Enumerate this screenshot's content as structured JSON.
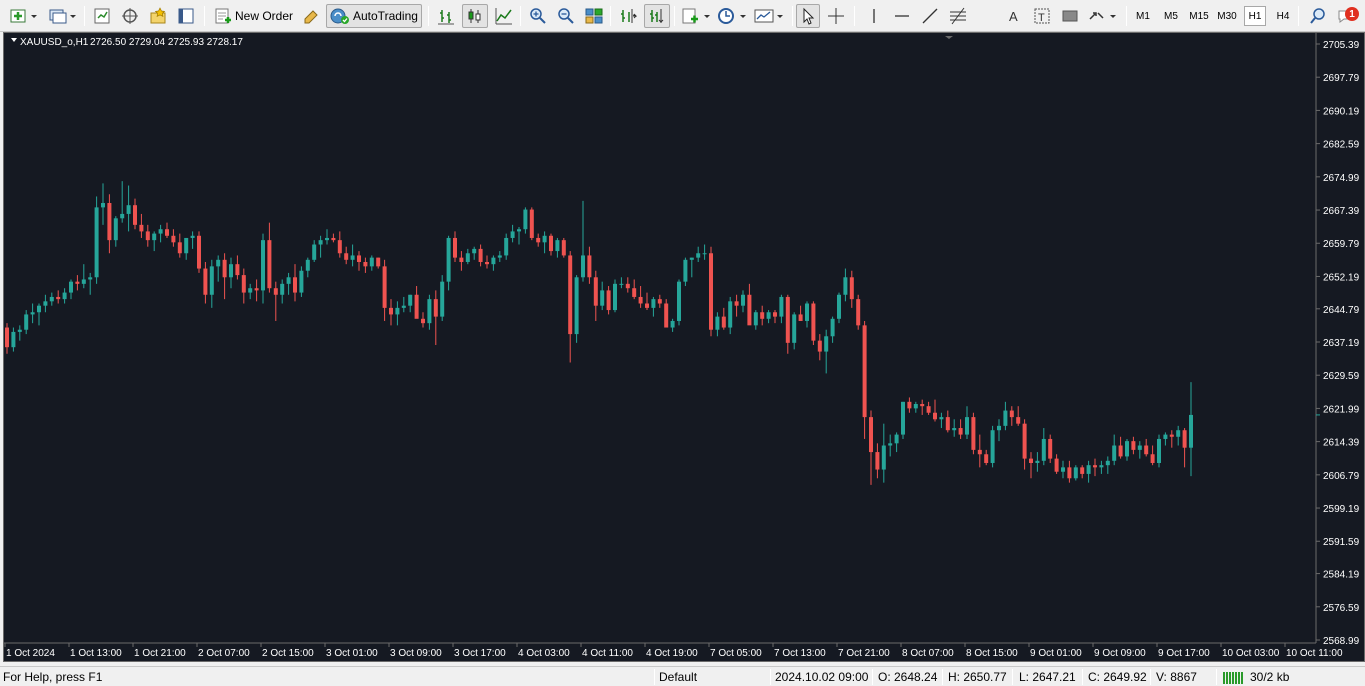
{
  "toolbar": {
    "new_order_label": "New Order",
    "autotrading_label": "AutoTrading",
    "timeframes": [
      "M1",
      "M5",
      "M15",
      "M30",
      "H1",
      "H4"
    ],
    "active_timeframe": "H1",
    "notification_count": "1",
    "icons": [
      "new-chart-icon",
      "profiles-icon",
      "market-watch-icon",
      "navigator-icon",
      "favorites-icon",
      "terminal-icon",
      "new-order-icon",
      "metaeditor-icon",
      "autotrading-icon",
      "bar-chart-icon",
      "candlestick-icon",
      "line-chart-icon",
      "zoom-in-icon",
      "zoom-out-icon",
      "tile-windows-icon",
      "chart-shift-icon",
      "autoscroll-icon",
      "indicators-icon",
      "periods-icon",
      "templates-icon",
      "cursor-icon",
      "crosshair-icon",
      "vertical-line-icon",
      "horizontal-line-icon",
      "trendline-icon",
      "fibonacci-icon",
      "text-icon",
      "text-label-icon",
      "rectangle-icon",
      "arrows-icon",
      "search-icon",
      "notifications-icon"
    ]
  },
  "chart": {
    "header": "XAUUSD_o,H1",
    "header_values": "2726.50 2729.04 2725.93 2728.17",
    "colors": {
      "background": "#151922",
      "bull": "#26a69a",
      "bear": "#ef5350",
      "axis_text": "#ffffff",
      "grid_border": "#6b6b6b"
    }
  },
  "chart_data": {
    "type": "candlestick",
    "symbol": "XAUUSD_o",
    "timeframe": "H1",
    "ylim": [
      2568.99,
      2705.39
    ],
    "y_ticks": [
      "2705.39",
      "2697.79",
      "2690.19",
      "2682.59",
      "2674.99",
      "2667.39",
      "2659.79",
      "2652.19",
      "2644.79",
      "2637.19",
      "2629.59",
      "2621.99",
      "2614.39",
      "2606.79",
      "2599.19",
      "2591.59",
      "2584.19",
      "2576.59",
      "2568.99"
    ],
    "x_ticks": [
      "1 Oct 2024",
      "1 Oct 13:00",
      "1 Oct 21:00",
      "2 Oct 07:00",
      "2 Oct 15:00",
      "3 Oct 01:00",
      "3 Oct 09:00",
      "3 Oct 17:00",
      "4 Oct 03:00",
      "4 Oct 11:00",
      "4 Oct 19:00",
      "7 Oct 05:00",
      "7 Oct 13:00",
      "7 Oct 21:00",
      "8 Oct 07:00",
      "8 Oct 15:00",
      "9 Oct 01:00",
      "9 Oct 09:00",
      "9 Oct 17:00",
      "10 Oct 03:00",
      "10 Oct 11:00"
    ],
    "last_price": 2620.5,
    "candles_ohlc": [
      [
        2640.5,
        2641.5,
        2634.5,
        2636.0
      ],
      [
        2636.0,
        2640.5,
        2635.0,
        2639.5
      ],
      [
        2639.5,
        2641.0,
        2637.5,
        2640.0
      ],
      [
        2640.0,
        2644.5,
        2639.0,
        2643.5
      ],
      [
        2643.5,
        2646.0,
        2641.5,
        2644.0
      ],
      [
        2644.0,
        2646.0,
        2641.0,
        2645.5
      ],
      [
        2645.5,
        2648.0,
        2644.0,
        2646.5
      ],
      [
        2646.5,
        2648.5,
        2645.5,
        2647.5
      ],
      [
        2647.5,
        2649.0,
        2646.0,
        2647.0
      ],
      [
        2647.0,
        2649.5,
        2646.0,
        2648.5
      ],
      [
        2648.5,
        2651.5,
        2647.0,
        2651.0
      ],
      [
        2651.0,
        2652.5,
        2649.0,
        2650.5
      ],
      [
        2650.5,
        2655.0,
        2649.5,
        2651.5
      ],
      [
        2651.5,
        2653.0,
        2648.0,
        2652.0
      ],
      [
        2652.0,
        2670.5,
        2650.5,
        2668.0
      ],
      [
        2668.0,
        2673.5,
        2664.0,
        2669.0
      ],
      [
        2669.0,
        2671.0,
        2657.5,
        2660.5
      ],
      [
        2660.5,
        2666.0,
        2659.0,
        2665.5
      ],
      [
        2665.5,
        2674.0,
        2664.5,
        2666.5
      ],
      [
        2666.5,
        2673.0,
        2662.5,
        2668.5
      ],
      [
        2668.5,
        2670.0,
        2663.0,
        2664.0
      ],
      [
        2664.0,
        2666.5,
        2661.0,
        2662.5
      ],
      [
        2662.5,
        2664.0,
        2659.0,
        2660.5
      ],
      [
        2660.5,
        2662.5,
        2658.0,
        2662.0
      ],
      [
        2662.0,
        2664.0,
        2660.0,
        2663.0
      ],
      [
        2663.0,
        2664.5,
        2661.0,
        2661.5
      ],
      [
        2661.5,
        2663.0,
        2659.0,
        2660.0
      ],
      [
        2660.0,
        2662.0,
        2656.5,
        2657.5
      ],
      [
        2657.5,
        2661.0,
        2656.0,
        2661.0
      ],
      [
        2661.0,
        2662.5,
        2658.5,
        2661.5
      ],
      [
        2661.5,
        2662.5,
        2653.0,
        2654.0
      ],
      [
        2654.0,
        2655.5,
        2646.0,
        2648.0
      ],
      [
        2648.0,
        2656.0,
        2645.0,
        2654.5
      ],
      [
        2654.5,
        2657.0,
        2651.0,
        2656.0
      ],
      [
        2656.0,
        2657.5,
        2647.0,
        2652.0
      ],
      [
        2652.0,
        2656.5,
        2649.5,
        2655.0
      ],
      [
        2655.0,
        2657.0,
        2651.5,
        2652.5
      ],
      [
        2652.5,
        2654.0,
        2646.0,
        2648.5
      ],
      [
        2648.5,
        2650.5,
        2647.0,
        2649.5
      ],
      [
        2649.5,
        2651.5,
        2646.5,
        2649.0
      ],
      [
        2649.0,
        2662.0,
        2646.0,
        2660.5
      ],
      [
        2660.5,
        2664.5,
        2648.5,
        2649.5
      ],
      [
        2649.5,
        2651.0,
        2642.0,
        2648.0
      ],
      [
        2648.0,
        2651.5,
        2646.0,
        2650.5
      ],
      [
        2650.5,
        2653.0,
        2648.0,
        2652.0
      ],
      [
        2652.0,
        2655.0,
        2646.5,
        2648.5
      ],
      [
        2648.5,
        2654.5,
        2647.5,
        2653.5
      ],
      [
        2653.5,
        2656.5,
        2652.0,
        2656.0
      ],
      [
        2656.0,
        2660.5,
        2655.5,
        2659.5
      ],
      [
        2659.5,
        2661.5,
        2656.5,
        2660.5
      ],
      [
        2660.5,
        2663.0,
        2659.5,
        2661.0
      ],
      [
        2661.0,
        2662.0,
        2660.0,
        2660.5
      ],
      [
        2660.5,
        2662.5,
        2656.5,
        2657.5
      ],
      [
        2657.5,
        2659.0,
        2655.0,
        2656.0
      ],
      [
        2656.0,
        2659.5,
        2654.5,
        2657.0
      ],
      [
        2657.0,
        2658.0,
        2653.5,
        2655.5
      ],
      [
        2655.5,
        2656.5,
        2653.0,
        2654.5
      ],
      [
        2654.5,
        2657.0,
        2653.5,
        2656.5
      ],
      [
        2656.5,
        2656.5,
        2654.0,
        2654.5
      ],
      [
        2654.5,
        2656.0,
        2642.0,
        2645.0
      ],
      [
        2645.0,
        2647.0,
        2641.0,
        2643.5
      ],
      [
        2643.5,
        2646.5,
        2641.0,
        2645.0
      ],
      [
        2645.0,
        2647.5,
        2644.0,
        2645.5
      ],
      [
        2645.5,
        2648.0,
        2644.0,
        2648.0
      ],
      [
        2648.0,
        2650.0,
        2645.0,
        2642.5
      ],
      [
        2642.5,
        2644.0,
        2640.5,
        2641.5
      ],
      [
        2641.5,
        2648.0,
        2640.0,
        2647.0
      ],
      [
        2647.0,
        2649.0,
        2636.5,
        2643.0
      ],
      [
        2643.0,
        2652.5,
        2642.0,
        2651.0
      ],
      [
        2651.0,
        2661.5,
        2649.0,
        2661.0
      ],
      [
        2661.0,
        2662.5,
        2655.5,
        2656.5
      ],
      [
        2656.5,
        2658.0,
        2653.5,
        2655.5
      ],
      [
        2655.5,
        2658.5,
        2655.0,
        2657.5
      ],
      [
        2657.5,
        2659.0,
        2656.0,
        2658.5
      ],
      [
        2658.5,
        2659.5,
        2654.5,
        2655.5
      ],
      [
        2655.5,
        2657.0,
        2654.0,
        2655.0
      ],
      [
        2655.0,
        2657.0,
        2653.5,
        2656.5
      ],
      [
        2656.5,
        2658.0,
        2655.5,
        2657.0
      ],
      [
        2657.0,
        2662.0,
        2656.0,
        2661.0
      ],
      [
        2661.0,
        2664.0,
        2660.0,
        2662.5
      ],
      [
        2662.5,
        2663.5,
        2659.5,
        2663.0
      ],
      [
        2663.0,
        2668.0,
        2662.0,
        2667.5
      ],
      [
        2667.5,
        2668.0,
        2660.5,
        2661.0
      ],
      [
        2661.0,
        2662.0,
        2659.0,
        2660.0
      ],
      [
        2660.0,
        2662.5,
        2657.5,
        2661.5
      ],
      [
        2661.5,
        2662.0,
        2657.0,
        2658.0
      ],
      [
        2658.0,
        2661.0,
        2656.5,
        2660.5
      ],
      [
        2660.5,
        2661.0,
        2656.5,
        2657.0
      ],
      [
        2657.0,
        2658.0,
        2632.5,
        2639.0
      ],
      [
        2639.0,
        2652.5,
        2637.0,
        2652.0
      ],
      [
        2652.0,
        2669.5,
        2651.0,
        2657.0
      ],
      [
        2657.0,
        2659.0,
        2650.5,
        2652.0
      ],
      [
        2652.0,
        2653.5,
        2642.0,
        2645.5
      ],
      [
        2645.5,
        2651.0,
        2644.5,
        2649.0
      ],
      [
        2649.0,
        2650.0,
        2643.5,
        2644.5
      ],
      [
        2644.5,
        2651.5,
        2644.0,
        2650.5
      ],
      [
        2650.5,
        2652.0,
        2649.5,
        2650.5
      ],
      [
        2650.5,
        2652.0,
        2648.5,
        2649.5
      ],
      [
        2649.5,
        2651.5,
        2647.0,
        2647.5
      ],
      [
        2647.5,
        2650.0,
        2645.0,
        2646.0
      ],
      [
        2646.0,
        2648.5,
        2644.5,
        2645.0
      ],
      [
        2645.0,
        2647.5,
        2643.0,
        2647.0
      ],
      [
        2647.0,
        2648.0,
        2645.0,
        2646.0
      ],
      [
        2646.0,
        2647.0,
        2643.0,
        2640.5
      ],
      [
        2640.5,
        2642.5,
        2639.5,
        2642.0
      ],
      [
        2642.0,
        2651.5,
        2641.0,
        2651.0
      ],
      [
        2651.0,
        2656.5,
        2650.0,
        2656.0
      ],
      [
        2656.0,
        2656.5,
        2652.0,
        2656.5
      ],
      [
        2656.5,
        2659.0,
        2655.5,
        2657.5
      ],
      [
        2657.5,
        2659.5,
        2656.0,
        2657.5
      ],
      [
        2657.5,
        2659.0,
        2638.5,
        2640.0
      ],
      [
        2640.0,
        2644.0,
        2638.5,
        2643.0
      ],
      [
        2643.0,
        2645.0,
        2640.0,
        2640.5
      ],
      [
        2640.5,
        2647.5,
        2639.0,
        2646.5
      ],
      [
        2646.5,
        2648.0,
        2643.0,
        2645.5
      ],
      [
        2645.5,
        2649.0,
        2644.0,
        2648.0
      ],
      [
        2648.0,
        2650.5,
        2646.0,
        2641.0
      ],
      [
        2641.0,
        2644.5,
        2640.0,
        2644.0
      ],
      [
        2644.0,
        2645.5,
        2641.0,
        2642.5
      ],
      [
        2642.5,
        2644.5,
        2641.5,
        2644.0
      ],
      [
        2644.0,
        2644.5,
        2641.5,
        2643.0
      ],
      [
        2643.0,
        2648.0,
        2641.5,
        2647.5
      ],
      [
        2647.5,
        2648.0,
        2634.5,
        2637.0
      ],
      [
        2637.0,
        2644.0,
        2635.5,
        2643.5
      ],
      [
        2643.5,
        2645.5,
        2642.0,
        2642.0
      ],
      [
        2642.0,
        2646.5,
        2640.5,
        2646.0
      ],
      [
        2646.0,
        2646.5,
        2636.5,
        2637.5
      ],
      [
        2637.5,
        2639.0,
        2633.0,
        2635.0
      ],
      [
        2635.0,
        2640.0,
        2630.0,
        2638.5
      ],
      [
        2638.5,
        2643.0,
        2637.0,
        2642.5
      ],
      [
        2642.5,
        2648.5,
        2641.5,
        2648.0
      ],
      [
        2648.0,
        2654.0,
        2646.5,
        2652.0
      ],
      [
        2652.0,
        2653.5,
        2645.0,
        2647.0
      ],
      [
        2647.0,
        2648.0,
        2640.0,
        2641.0
      ],
      [
        2641.0,
        2642.0,
        2615.0,
        2620.0
      ],
      [
        2620.0,
        2621.5,
        2604.5,
        2612.0
      ],
      [
        2612.0,
        2614.0,
        2606.0,
        2608.0
      ],
      [
        2608.0,
        2618.5,
        2605.0,
        2613.5
      ],
      [
        2613.5,
        2616.0,
        2611.0,
        2614.0
      ],
      [
        2614.0,
        2616.5,
        2612.0,
        2616.0
      ],
      [
        2616.0,
        2623.5,
        2615.0,
        2623.5
      ],
      [
        2623.5,
        2624.5,
        2621.0,
        2622.0
      ],
      [
        2622.0,
        2623.5,
        2621.0,
        2623.0
      ],
      [
        2623.0,
        2624.0,
        2620.5,
        2622.5
      ],
      [
        2622.5,
        2623.5,
        2620.5,
        2621.0
      ],
      [
        2621.0,
        2624.0,
        2619.0,
        2619.5
      ],
      [
        2619.5,
        2621.0,
        2617.5,
        2620.0
      ],
      [
        2620.0,
        2621.5,
        2616.5,
        2617.0
      ],
      [
        2617.0,
        2619.5,
        2615.5,
        2617.5
      ],
      [
        2617.5,
        2619.5,
        2615.0,
        2616.0
      ],
      [
        2616.0,
        2622.5,
        2615.0,
        2620.0
      ],
      [
        2620.0,
        2621.0,
        2611.5,
        2612.5
      ],
      [
        2612.5,
        2616.0,
        2608.5,
        2611.5
      ],
      [
        2611.5,
        2612.5,
        2609.0,
        2609.5
      ],
      [
        2609.5,
        2618.0,
        2608.5,
        2617.0
      ],
      [
        2617.0,
        2619.5,
        2614.5,
        2618.0
      ],
      [
        2618.0,
        2623.5,
        2617.0,
        2621.5
      ],
      [
        2621.5,
        2622.5,
        2618.0,
        2620.0
      ],
      [
        2620.0,
        2622.5,
        2618.0,
        2618.5
      ],
      [
        2618.5,
        2619.5,
        2608.0,
        2610.5
      ],
      [
        2610.5,
        2612.0,
        2606.0,
        2609.5
      ],
      [
        2609.5,
        2612.0,
        2607.5,
        2610.0
      ],
      [
        2610.0,
        2617.5,
        2609.0,
        2615.0
      ],
      [
        2615.0,
        2616.0,
        2609.5,
        2610.5
      ],
      [
        2610.5,
        2611.5,
        2607.0,
        2607.5
      ],
      [
        2607.5,
        2610.0,
        2606.0,
        2608.5
      ],
      [
        2608.5,
        2610.0,
        2605.0,
        2606.0
      ],
      [
        2606.0,
        2609.0,
        2605.5,
        2608.5
      ],
      [
        2608.5,
        2609.0,
        2606.0,
        2607.0
      ],
      [
        2607.0,
        2610.0,
        2605.0,
        2609.0
      ],
      [
        2609.0,
        2610.5,
        2606.5,
        2608.5
      ],
      [
        2608.5,
        2610.0,
        2607.0,
        2609.0
      ],
      [
        2609.0,
        2611.0,
        2607.0,
        2610.0
      ],
      [
        2610.0,
        2616.0,
        2609.0,
        2613.5
      ],
      [
        2613.5,
        2615.5,
        2610.5,
        2611.0
      ],
      [
        2611.0,
        2615.0,
        2610.0,
        2614.5
      ],
      [
        2614.5,
        2615.5,
        2611.5,
        2612.5
      ],
      [
        2612.5,
        2614.5,
        2610.5,
        2613.5
      ],
      [
        2613.5,
        2615.0,
        2611.0,
        2611.5
      ],
      [
        2611.5,
        2613.5,
        2609.0,
        2609.5
      ],
      [
        2609.5,
        2616.0,
        2608.5,
        2615.0
      ],
      [
        2615.0,
        2616.5,
        2613.5,
        2616.0
      ],
      [
        2616.0,
        2617.0,
        2613.0,
        2615.5
      ],
      [
        2615.5,
        2618.0,
        2613.5,
        2617.0
      ],
      [
        2617.0,
        2617.5,
        2608.5,
        2613.0
      ],
      [
        2613.0,
        2628.0,
        2606.5,
        2620.5
      ]
    ]
  },
  "status": {
    "help": "For Help, press F1",
    "profile": "Default",
    "datetime": "2024.10.02 09:00",
    "open": "O: 2648.24",
    "high": "H: 2650.77",
    "low": "L: 2647.21",
    "close": "C: 2649.92",
    "volume": "V: 8867",
    "traffic": "30/2 kb"
  }
}
